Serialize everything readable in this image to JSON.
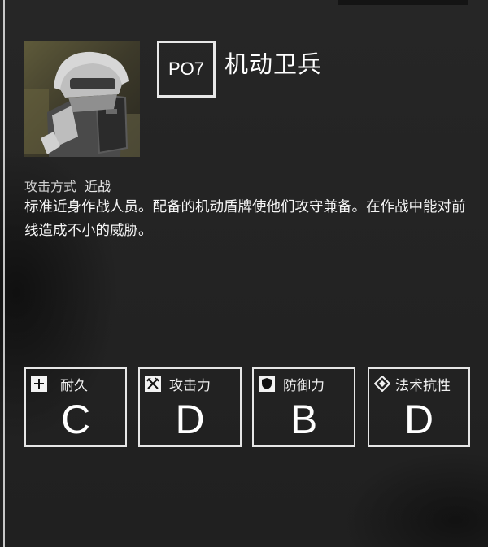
{
  "unit": {
    "code": "PO7",
    "name": "机动卫兵",
    "attack_type_label": "攻击方式",
    "attack_type_value": "近战",
    "description": "标准近身作战人员。配备的机动盾牌使他们攻守兼备。在作战中能对前线造成不小的威胁。"
  },
  "stats": [
    {
      "label": "耐久",
      "grade": "C",
      "icon": "plus-icon"
    },
    {
      "label": "攻击力",
      "grade": "D",
      "icon": "crossed-swords-icon"
    },
    {
      "label": "防御力",
      "grade": "B",
      "icon": "shield-icon"
    },
    {
      "label": "法术抗性",
      "grade": "D",
      "icon": "diamond-icon"
    }
  ],
  "colors": {
    "background": "#232323",
    "border": "#e6e6e6",
    "text": "#f2f2f2"
  }
}
